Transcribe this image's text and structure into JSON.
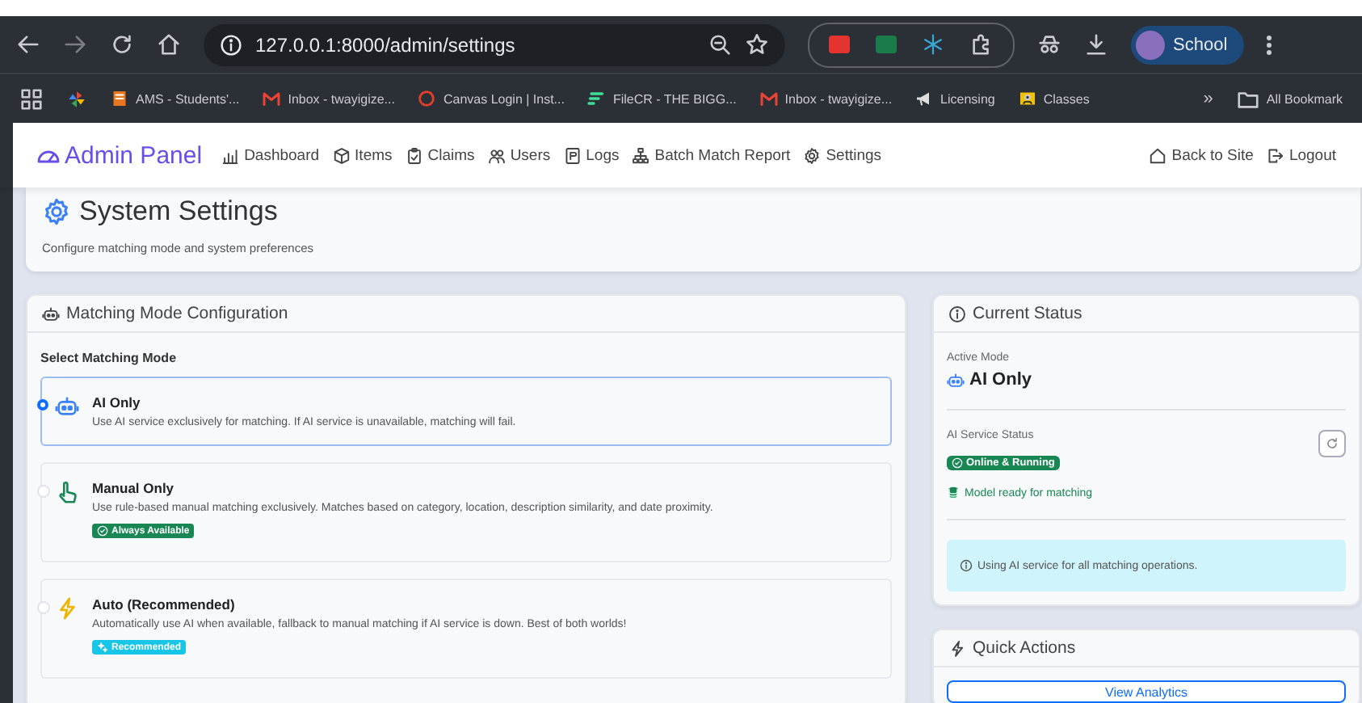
{
  "browser": {
    "url": "127.0.0.1:8000/admin/settings",
    "profile": "School",
    "bookmarks": [
      {
        "kind": "ams",
        "label": "AMS - Students'..."
      },
      {
        "kind": "mail",
        "label": "Inbox - twayigize..."
      },
      {
        "kind": "canvas",
        "label": "Canvas Login | Inst..."
      },
      {
        "kind": "filecr",
        "label": "FileCR - THE BIGG..."
      },
      {
        "kind": "mail",
        "label": "Inbox - twayigize..."
      },
      {
        "kind": "licensing",
        "label": "Licensing"
      },
      {
        "kind": "classes",
        "label": "Classes"
      }
    ],
    "overflow": "»",
    "all_bookmarks": "All Bookmark"
  },
  "nav": {
    "brand": "Admin Panel",
    "links": [
      {
        "kind": "chart",
        "label": "Dashboard"
      },
      {
        "kind": "box",
        "label": "Items"
      },
      {
        "kind": "clipboard",
        "label": "Claims"
      },
      {
        "kind": "users",
        "label": "Users"
      },
      {
        "kind": "doc",
        "label": "Logs"
      },
      {
        "kind": "tree",
        "label": "Batch Match Report"
      },
      {
        "kind": "gear",
        "label": "Settings"
      }
    ],
    "right_links": [
      {
        "kind": "house",
        "label": "Back to Site"
      },
      {
        "kind": "exit",
        "label": "Logout"
      }
    ]
  },
  "header": {
    "title": "System Settings",
    "subtitle": "Configure matching mode and system preferences"
  },
  "matching": {
    "title": "Matching Mode Configuration",
    "label": "Select Matching Mode",
    "options": [
      {
        "kind": "robot",
        "title": "AI Only",
        "description": "Use AI service exclusively for matching. If AI service is unavailable, matching will fail.",
        "selected": true
      },
      {
        "kind": "hand",
        "title": "Manual Only",
        "description": "Use rule-based manual matching exclusively. Matches based on category, location, description similarity, and date proximity.",
        "selected": false,
        "badge": {
          "kind": "success",
          "text": "Always Available"
        }
      },
      {
        "kind": "bolt",
        "title": "Auto (Recommended)",
        "description": "Automatically use AI when available, fallback to manual matching if AI service is down. Best of both worlds!",
        "selected": false,
        "badge": {
          "kind": "info",
          "text": "Recommended"
        }
      }
    ]
  },
  "status": {
    "title": "Current Status",
    "active_mode_label": "Active Mode",
    "active_mode": "AI Only",
    "service_label": "AI Service Status",
    "service_badge": "Online & Running",
    "model_note": "Model ready for matching",
    "info": "Using AI service for all matching operations."
  },
  "quick_actions": {
    "title": "Quick Actions",
    "buttons": [
      "View Analytics"
    ]
  }
}
